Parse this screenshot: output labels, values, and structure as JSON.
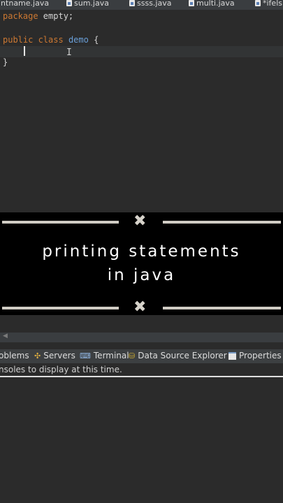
{
  "tabs": [
    {
      "label": "intname.java"
    },
    {
      "label": "sum.java"
    },
    {
      "label": "ssss.java"
    },
    {
      "label": "multi.java"
    },
    {
      "label": "*ifels"
    }
  ],
  "editor": {
    "line1_kw": "package",
    "line1_rest": " empty;",
    "line2_kw1": "public",
    "line2_kw2": " class",
    "line2_cls": " demo",
    "line2_rest": " {",
    "line4": "}"
  },
  "overlay": {
    "caption_line1": "printing statements",
    "caption_line2": "in java",
    "bg": "#000000"
  },
  "views": {
    "problems": "oblems",
    "servers": "Servers",
    "terminal": "Terminal",
    "datasource": "Data Source Explorer",
    "properties": "Properties"
  },
  "console": {
    "message": "nsoles to display at this time."
  },
  "colors": {
    "keyword": "#cc7832",
    "classname": "#6a9fd8",
    "editor_bg": "#2b2b2b"
  }
}
